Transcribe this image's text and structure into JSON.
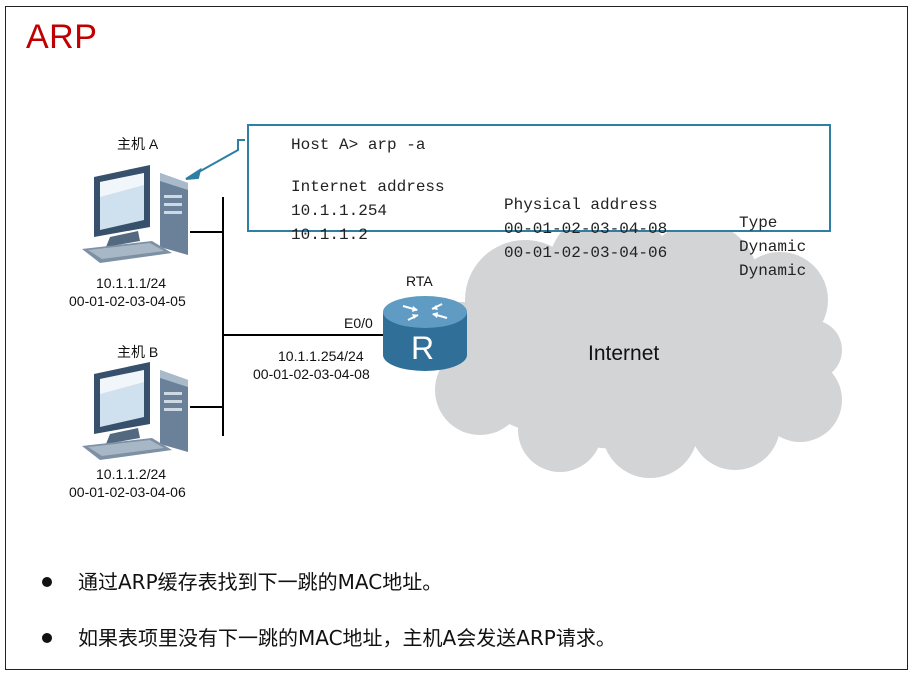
{
  "title": "ARP",
  "host_a": {
    "name": "主机 A",
    "ip": "10.1.1.1/24",
    "mac": "00-01-02-03-04-05"
  },
  "host_b": {
    "name": "主机 B",
    "ip": "10.1.1.2/24",
    "mac": "00-01-02-03-04-06"
  },
  "router": {
    "name": "RTA",
    "interface": "E0/0",
    "ip": "10.1.1.254/24",
    "mac": "00-01-02-03-04-08",
    "glyph": "R"
  },
  "cloud_label": "Internet",
  "arp_table": {
    "command": "Host A> arp -a",
    "headers": [
      "Internet address",
      "Physical address",
      "Type"
    ],
    "rows": [
      [
        "10.1.1.254",
        "00-01-02-03-04-08",
        "Dynamic"
      ],
      [
        "10.1.1.2",
        "00-01-02-03-04-06",
        "Dynamic"
      ]
    ]
  },
  "bullets": [
    "通过ARP缓存表找到下一跳的MAC地址。",
    "如果表项里没有下一跳的MAC地址，主机A会发送ARP请求。"
  ],
  "colors": {
    "title": "#c00000",
    "box_border": "#2f7fa5",
    "router": "#2f6f98",
    "cloud": "#d2d4d6"
  }
}
